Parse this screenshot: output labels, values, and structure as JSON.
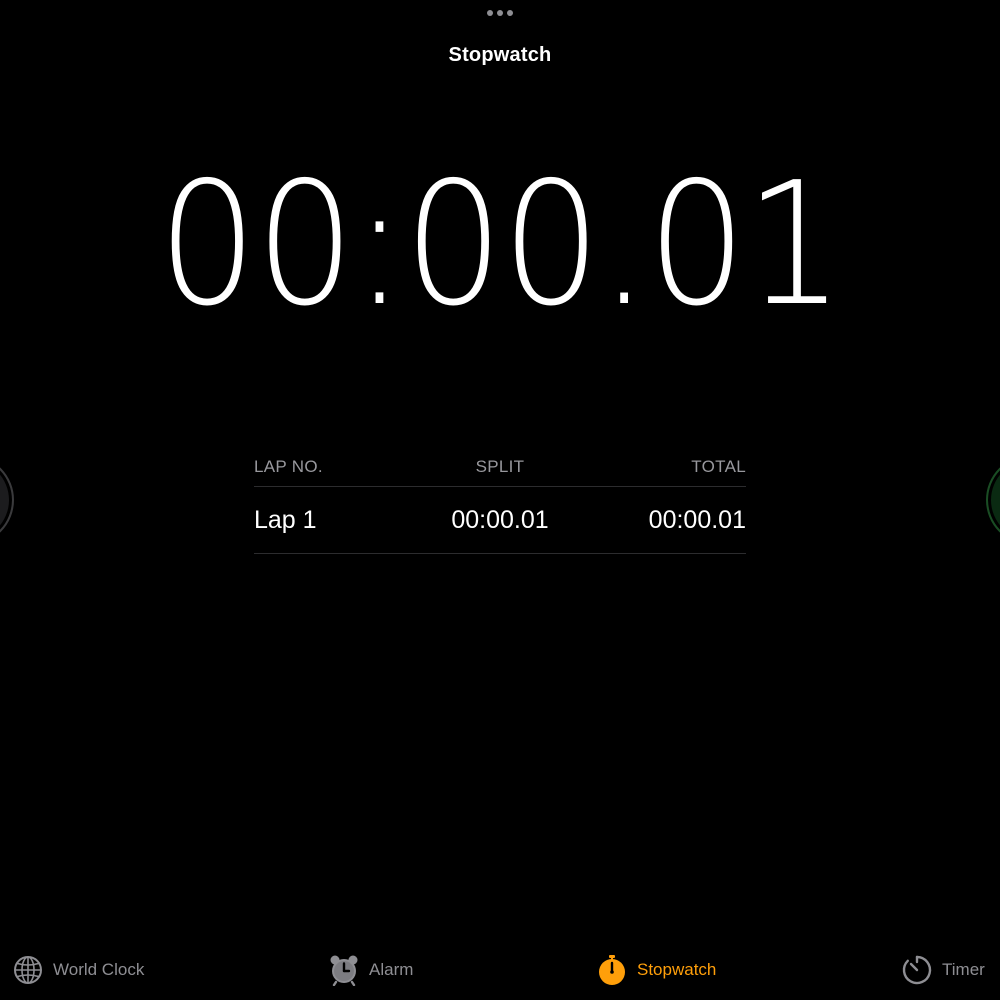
{
  "header": {
    "title": "Stopwatch"
  },
  "stopwatch": {
    "display_time": "00:00.01"
  },
  "laps": {
    "columns": {
      "lap_no": "LAP NO.",
      "split": "SPLIT",
      "total": "TOTAL"
    },
    "rows": [
      {
        "lap": "Lap 1",
        "split": "00:00.01",
        "total": "00:00.01"
      }
    ]
  },
  "tabbar": {
    "active_color": "#ff9f0a",
    "inactive_color": "#8e8e93",
    "tabs": [
      {
        "label": "World Clock",
        "icon": "globe-icon",
        "active": false
      },
      {
        "label": "Alarm",
        "icon": "alarm-clock-icon",
        "active": false
      },
      {
        "label": "Stopwatch",
        "icon": "stopwatch-icon",
        "active": true
      },
      {
        "label": "Timer",
        "icon": "timer-icon",
        "active": false
      }
    ]
  },
  "colors": {
    "background": "#000000",
    "left_button": "#1c1c1e",
    "right_button": "#0a2a12"
  }
}
